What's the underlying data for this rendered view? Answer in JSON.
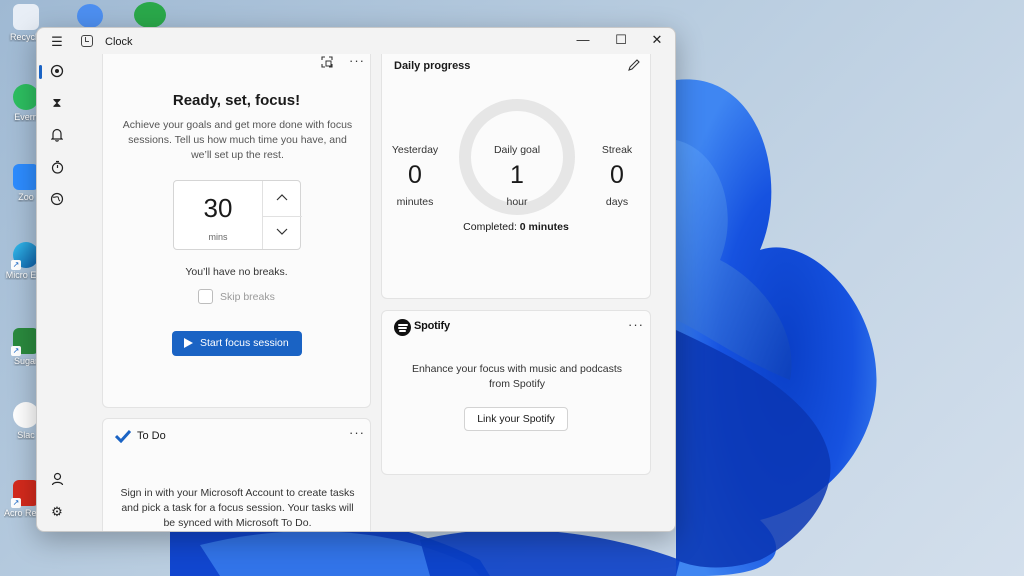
{
  "desktop": {
    "icons": [
      {
        "label": "Recycle"
      },
      {
        "label": "Evern"
      },
      {
        "label": "Zoo"
      },
      {
        "label": "Micro Edg"
      },
      {
        "label": "Sugar"
      },
      {
        "label": "Slac"
      },
      {
        "label": "Acro Reader DC"
      }
    ]
  },
  "window": {
    "title": "Clock",
    "controls": {
      "minimize": "—",
      "maximize": "☐",
      "close": "✕"
    }
  },
  "nav": {
    "menu_icon": "hamburger-icon",
    "items": [
      {
        "name": "focus-sessions",
        "icon": "focus-icon",
        "active": true
      },
      {
        "name": "timer",
        "icon": "hourglass-icon"
      },
      {
        "name": "alarm",
        "icon": "bell-icon"
      },
      {
        "name": "stopwatch",
        "icon": "stopwatch-icon"
      },
      {
        "name": "world-clock",
        "icon": "globe-icon"
      }
    ],
    "bottom": [
      {
        "name": "account",
        "icon": "person-icon"
      },
      {
        "name": "settings",
        "icon": "gear-icon"
      }
    ]
  },
  "focus": {
    "title": "Ready, set, focus!",
    "description": "Achieve your goals and get more done with focus sessions. Tell us how much time you have, and we’ll set up the rest.",
    "minutes_value": "30",
    "minutes_unit": "mins",
    "breaks_text": "You’ll have no breaks.",
    "skip_breaks_label": "Skip breaks",
    "start_label": "Start focus session",
    "accent": "#1a63c4"
  },
  "todo": {
    "title": "To Do",
    "description": "Sign in with your Microsoft Account to create tasks and pick a task for a focus session. Your tasks will be synced with Microsoft To Do."
  },
  "progress": {
    "title": "Daily progress",
    "yesterday_label": "Yesterday",
    "yesterday_value": "0",
    "yesterday_unit": "minutes",
    "goal_label": "Daily goal",
    "goal_value": "1",
    "goal_unit": "hour",
    "streak_label": "Streak",
    "streak_value": "0",
    "streak_unit": "days",
    "completed_prefix": "Completed:",
    "completed_value": "0 minutes",
    "ring_fraction": 0
  },
  "spotify": {
    "name": "Spotify",
    "description": "Enhance your focus with music and podcasts from Spotify",
    "link_label": "Link your Spotify"
  },
  "more_label": "···"
}
